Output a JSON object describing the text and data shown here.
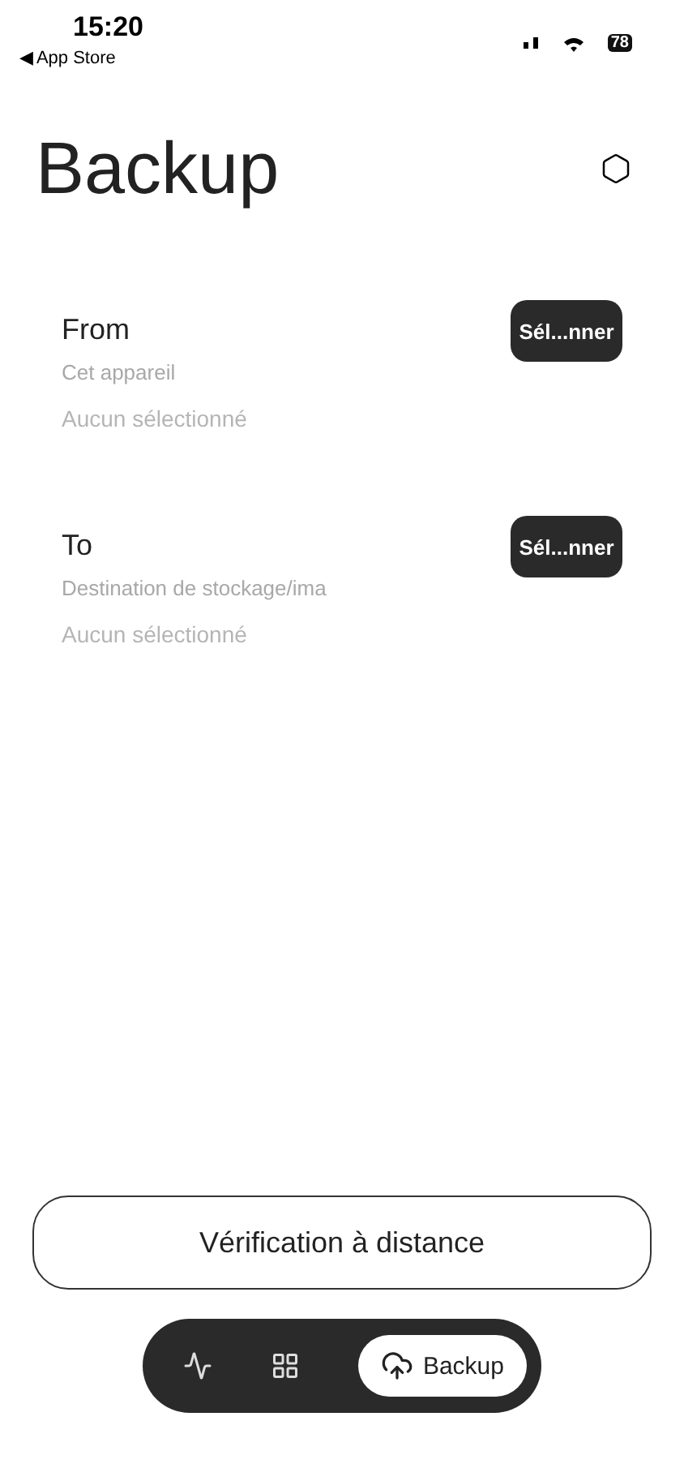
{
  "status_bar": {
    "time": "15:20",
    "back_link": "◀ App Store",
    "battery": "78"
  },
  "title": "Backup",
  "sections": [
    {
      "label": "From",
      "hint": "Cet appareil",
      "value": "Aucun sélectionné",
      "button": "Sél...nner"
    },
    {
      "label": "To",
      "hint": "Destination de stockage/ima",
      "value": "Aucun sélectionné",
      "button": "Sél...nner"
    }
  ],
  "action_button": "Vérification à distance",
  "tabs": [
    {
      "kind": "activity",
      "selected": false
    },
    {
      "kind": "grid",
      "selected": false
    },
    {
      "kind": "cloud",
      "label": "Backup",
      "selected": true
    }
  ]
}
